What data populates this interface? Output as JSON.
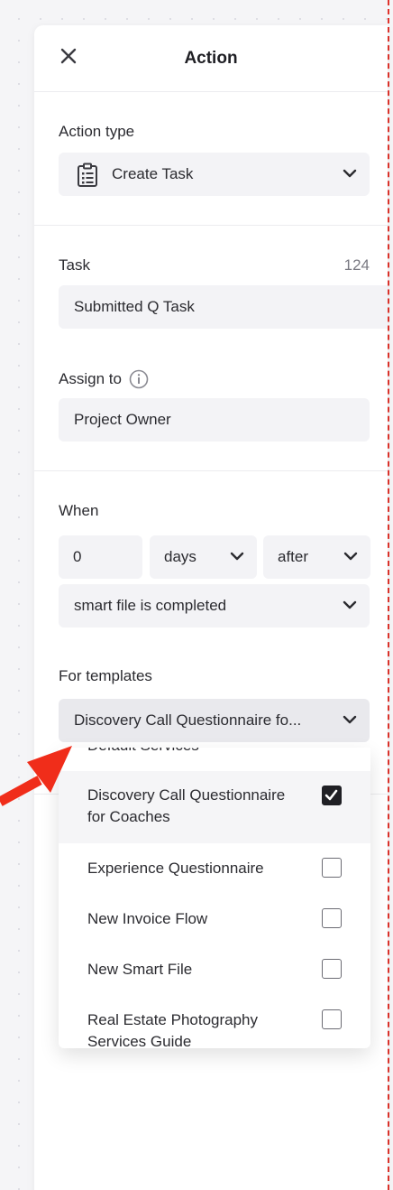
{
  "header": {
    "title": "Action"
  },
  "action_type": {
    "label": "Action type",
    "value": "Create Task"
  },
  "task": {
    "label": "Task",
    "counter": "124",
    "value": "Submitted Q Task"
  },
  "assign_to": {
    "label": "Assign to",
    "value": "Project Owner"
  },
  "when": {
    "label": "When",
    "amount": "0",
    "unit": "days",
    "relation": "after",
    "trigger": "smart file is completed"
  },
  "templates": {
    "label": "For templates",
    "selected_display": "Discovery Call Questionnaire fo...",
    "options": [
      {
        "label": "Default Services",
        "checked": false
      },
      {
        "label_line1": "Discovery Call Questionnaire",
        "label_line2": "for Coaches",
        "checked": true
      },
      {
        "label": "Experience Questionnaire",
        "checked": false
      },
      {
        "label": "New Invoice Flow",
        "checked": false
      },
      {
        "label": "New Smart File",
        "checked": false
      },
      {
        "label_line1": "Real Estate Photography",
        "label_line2": "Services Guide",
        "checked": false
      }
    ]
  },
  "colors": {
    "annotation_arrow": "#f02d1a",
    "dashed_border": "#e0332c"
  }
}
